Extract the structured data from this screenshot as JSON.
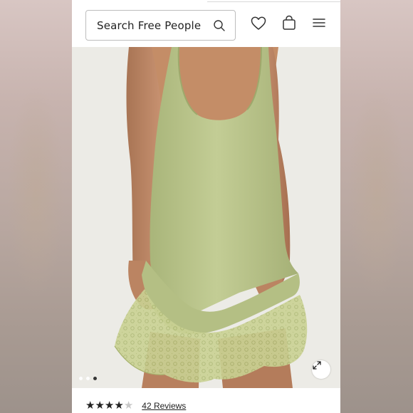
{
  "header": {
    "search_placeholder": "Search Free People",
    "icons": [
      "search-icon",
      "heart-icon",
      "bag-icon",
      "menu-icon"
    ]
  },
  "hero": {
    "carousel_dots": 3,
    "active_dot": 3,
    "expand_icon": "expand-icon"
  },
  "product": {
    "rating": 4,
    "rating_max": 5,
    "reviews_label": "42 Reviews"
  },
  "colors": {
    "dress": "#b9c48a",
    "lace": "#c6cf8f",
    "skin": "#c48d67",
    "backdrop": "#ece9e4",
    "text": "#222222"
  }
}
